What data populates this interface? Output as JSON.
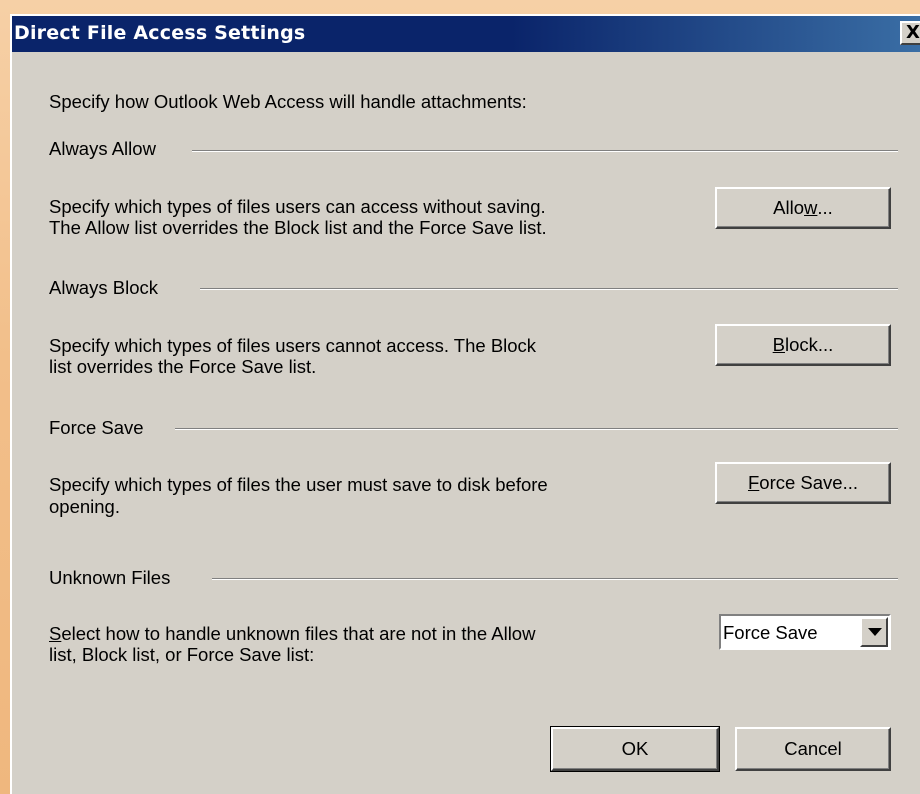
{
  "dialog": {
    "title": "Direct File Access Settings",
    "close_label": "X"
  },
  "intro": "Specify how Outlook Web Access will handle attachments:",
  "groups": [
    {
      "label": "Always Allow",
      "lines": [
        "Specify which types of files users can access without saving.",
        "The Allow list overrides the Block list and the Force Save list."
      ],
      "button_pre": "Allo",
      "button_accel": "w",
      "button_post": "..."
    },
    {
      "label": "Always Block",
      "lines": [
        "Specify which types of files users cannot access. The Block",
        "list overrides the Force Save list."
      ],
      "button_pre": "",
      "button_accel": "B",
      "button_post": "lock..."
    },
    {
      "label": "Force Save",
      "lines": [
        "Specify which types of files the user must save to disk before",
        "opening."
      ],
      "button_pre": "",
      "button_accel": "F",
      "button_post": "orce Save..."
    },
    {
      "label": "Unknown Files",
      "lines_accel": "S",
      "lines": [
        "elect how to handle unknown files that are not in the Allow",
        "list, Block list, or Force Save list:"
      ],
      "select_value": "Force Save"
    }
  ],
  "footer": {
    "ok_label": "OK",
    "cancel_label": "Cancel"
  }
}
